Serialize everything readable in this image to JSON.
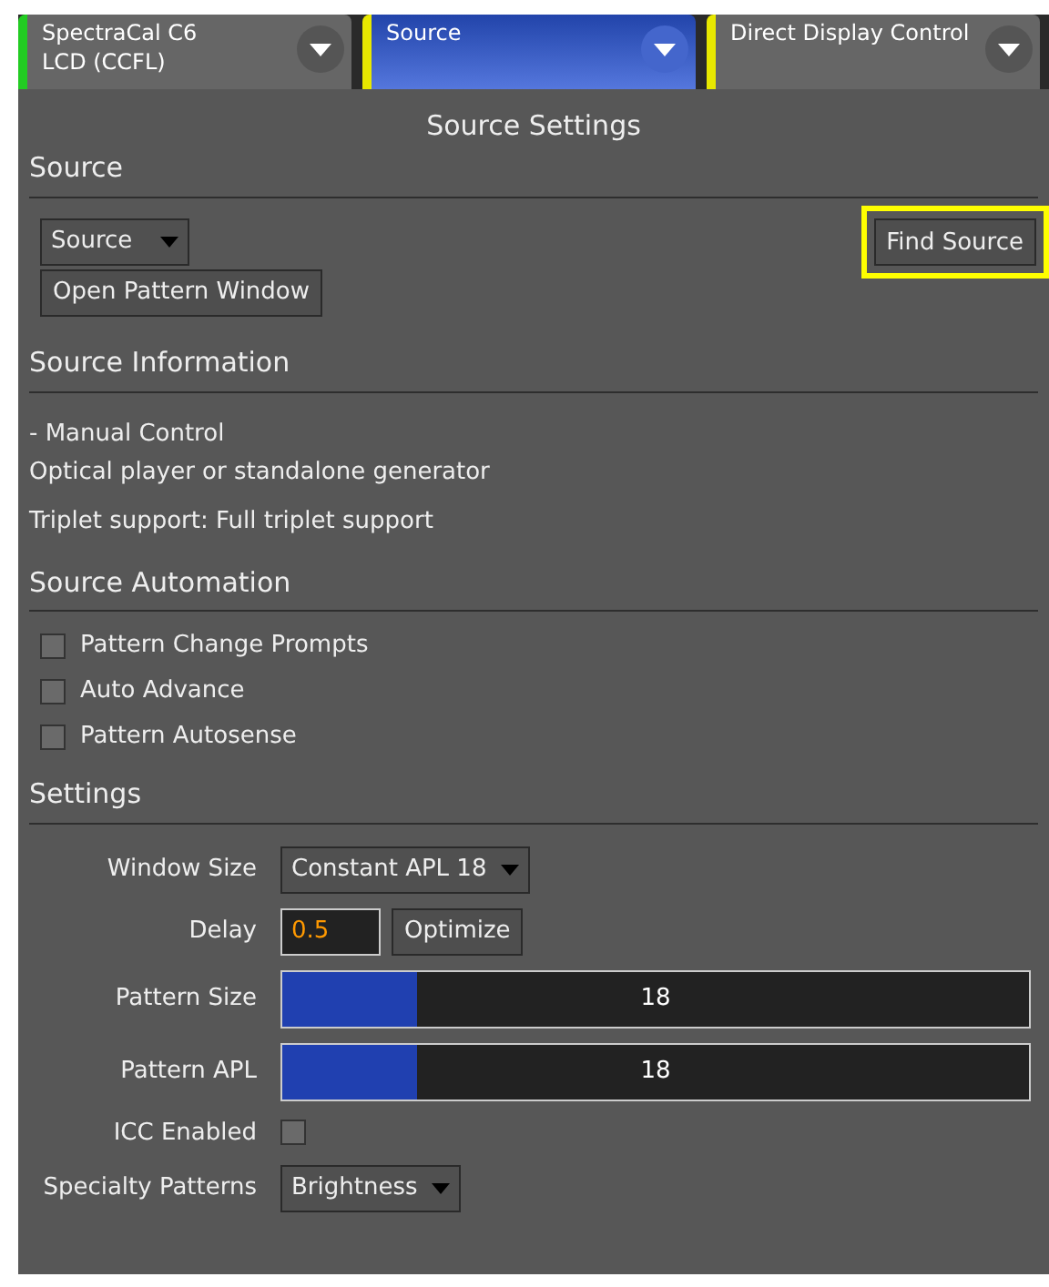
{
  "tabs": [
    {
      "label": "SpectraCal C6\nLCD (CCFL)",
      "selected": false,
      "color": "#22cc22"
    },
    {
      "label": "Source",
      "selected": true,
      "color": "#e8e800"
    },
    {
      "label": "Direct Display Control",
      "selected": false,
      "color": "#e8e800"
    }
  ],
  "title": "Source Settings",
  "source": {
    "header": "Source",
    "dropdown": "Source",
    "find_button": "Find Source",
    "find_highlighted": true,
    "open_button": "Open Pattern Window"
  },
  "info": {
    "header": "Source Information",
    "lines": [
      "- Manual Control",
      "Optical player or standalone generator"
    ],
    "triplet": "Triplet support: Full triplet support"
  },
  "automation": {
    "header": "Source Automation",
    "options": [
      {
        "label": "Pattern Change Prompts",
        "checked": false
      },
      {
        "label": "Auto Advance",
        "checked": false
      },
      {
        "label": "Pattern Autosense",
        "checked": false
      }
    ]
  },
  "settings": {
    "header": "Settings",
    "rows": [
      {
        "kind": "dropdown",
        "label": "Window Size",
        "value": "Constant APL 18"
      },
      {
        "kind": "number",
        "label": "Delay",
        "value": "0.5",
        "button": "Optimize"
      },
      {
        "kind": "slider",
        "label": "Pattern Size",
        "level": 0.18,
        "reading": "18"
      },
      {
        "kind": "slider",
        "label": "Pattern APL",
        "level": 0.18,
        "reading": "18"
      },
      {
        "kind": "checkbox",
        "label": "ICC Enabled",
        "checked": false
      },
      {
        "kind": "dropdown",
        "label": "Specialty Patterns",
        "value": "Brightness"
      }
    ]
  }
}
